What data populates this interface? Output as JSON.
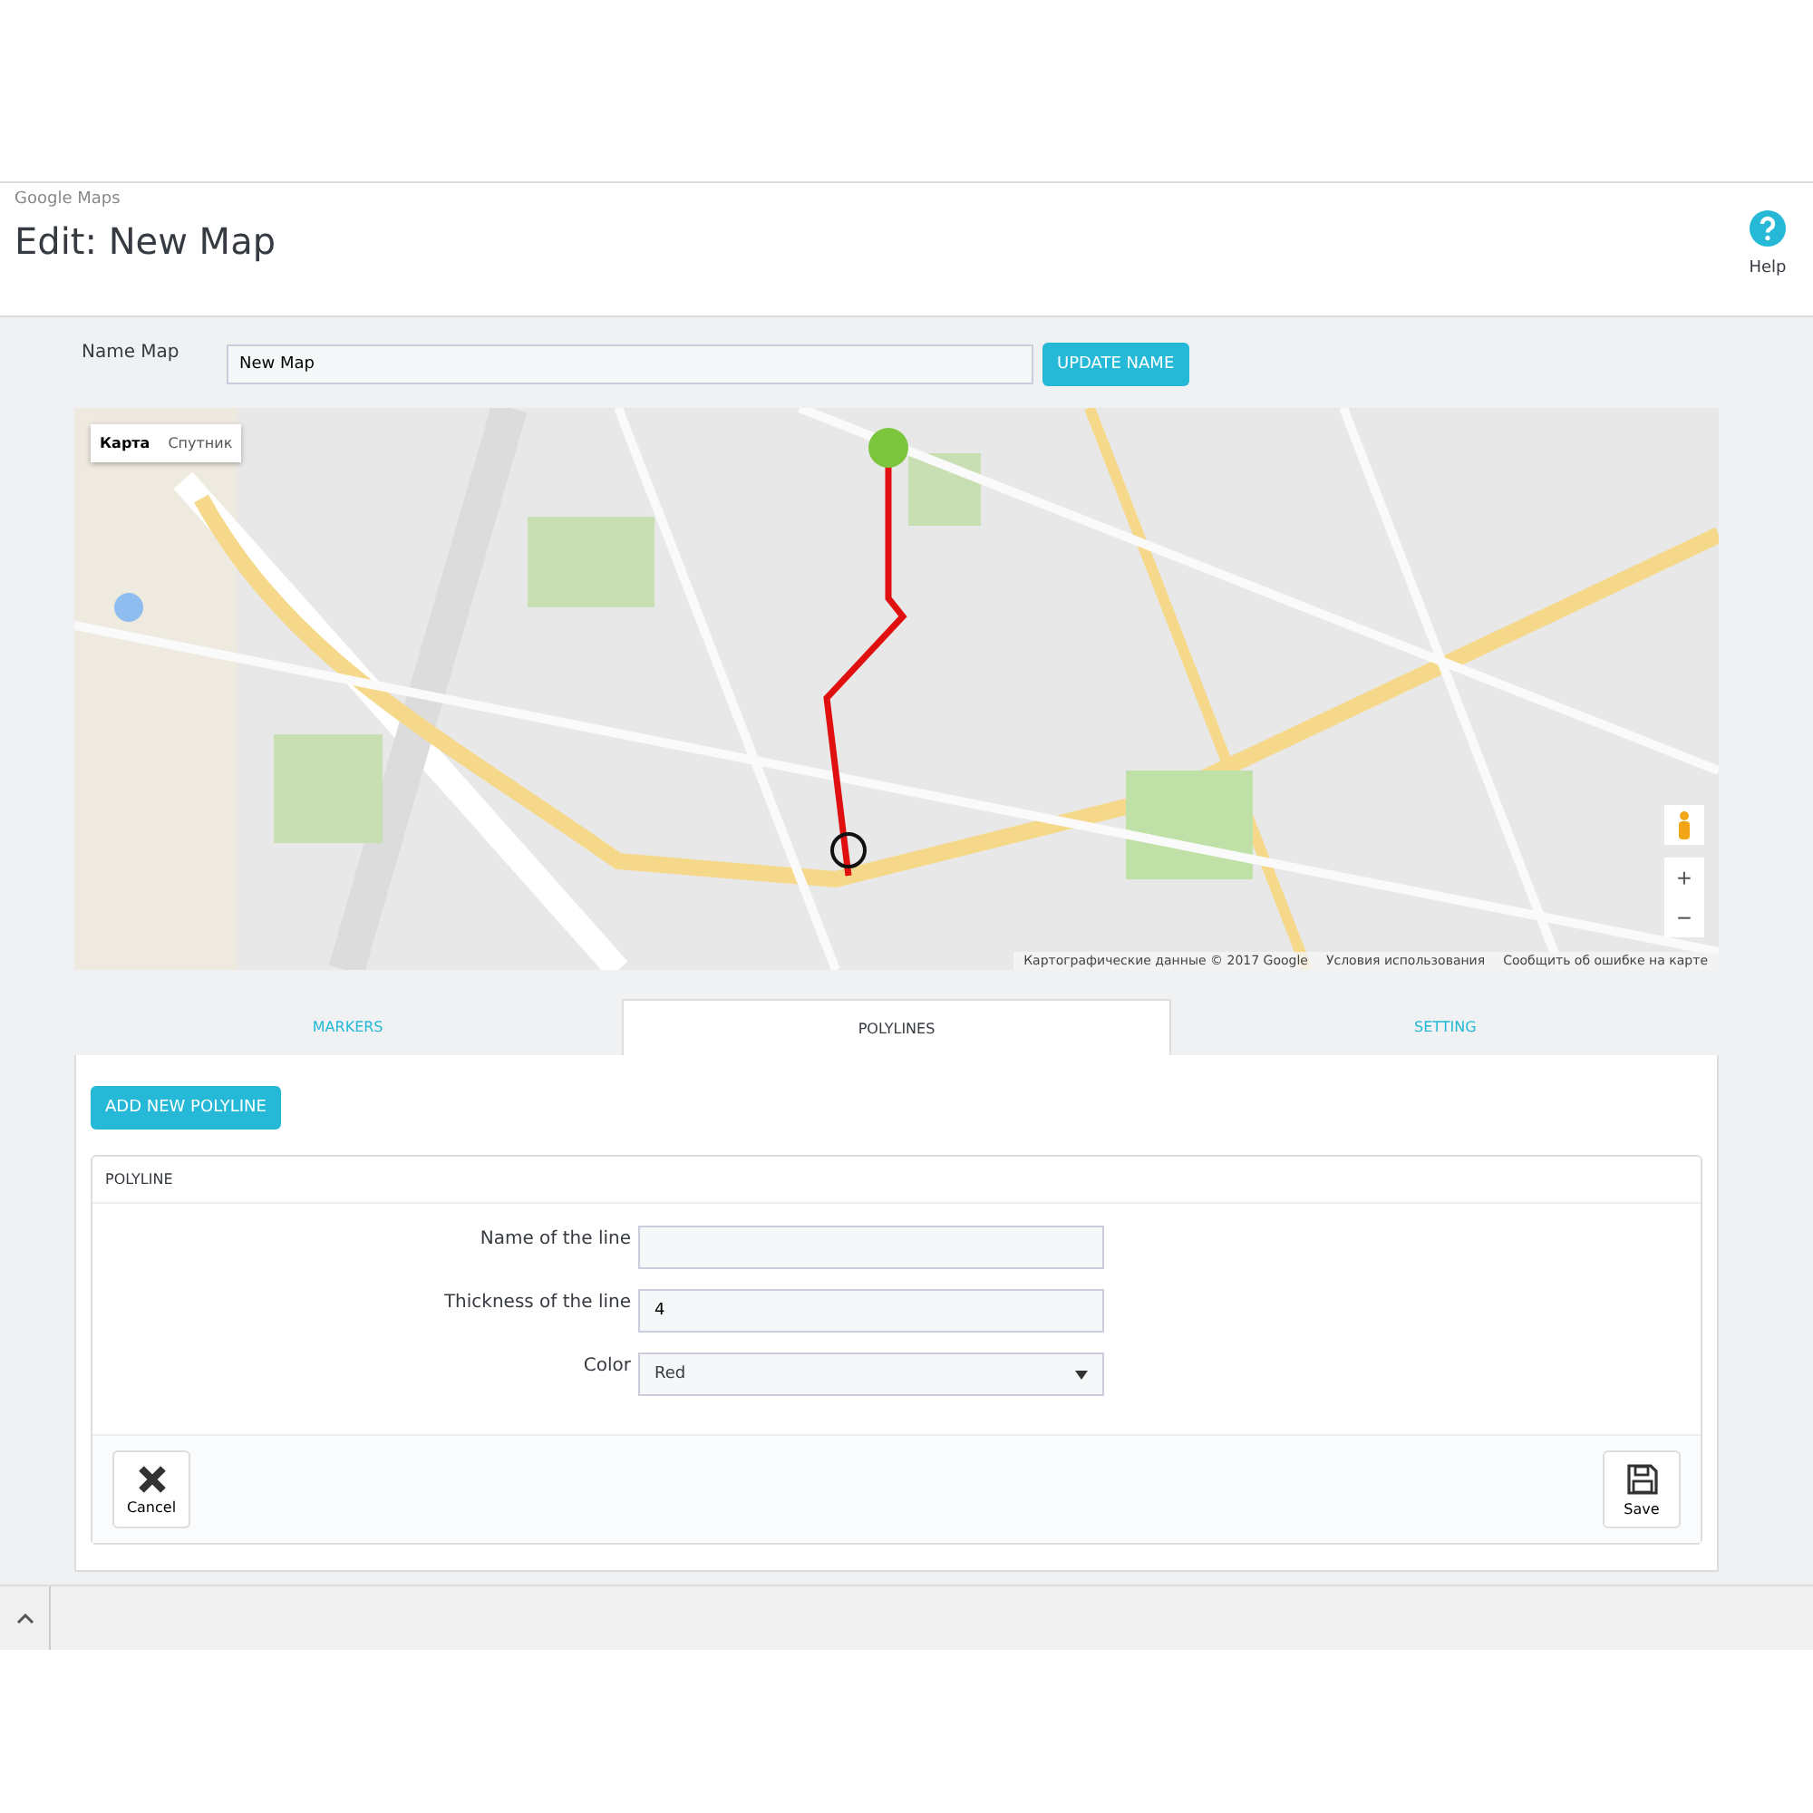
{
  "header": {
    "breadcrumb": "Google Maps",
    "title": "Edit: New Map",
    "help": "Help"
  },
  "name_map": {
    "label": "Name Map",
    "value": "New Map",
    "button": "UPDATE NAME"
  },
  "map": {
    "kind": "picture",
    "map_types": [
      {
        "label": "Карта",
        "selected": true
      },
      {
        "label": "Спутник",
        "selected": false
      }
    ],
    "zoom": [
      "+",
      "−"
    ],
    "attribution": [
      "Картографические данные © 2017 Google",
      "Условия использования",
      "Сообщить об ошибке на карте"
    ]
  },
  "tabs": [
    {
      "label": "MARKERS",
      "selected": false
    },
    {
      "label": "POLYLINES",
      "selected": true
    },
    {
      "label": "SETTING",
      "selected": false
    }
  ],
  "add_button": "ADD NEW POLYLINE",
  "panel": {
    "title": "POLYLINE",
    "fields": [
      {
        "kind": "text",
        "label": "Name of the line"
      },
      {
        "kind": "text",
        "label": "Thickness of the line",
        "value": "4"
      },
      {
        "kind": "select",
        "label": "Color",
        "value": "Red"
      }
    ],
    "cancel": "Cancel",
    "save": "Save"
  }
}
